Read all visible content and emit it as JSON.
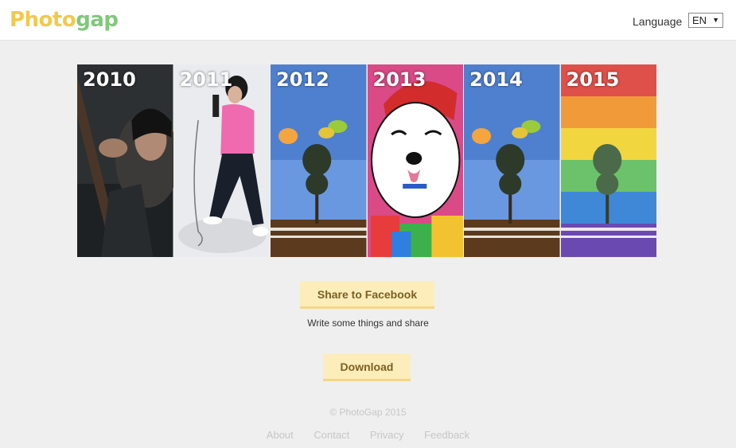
{
  "header": {
    "logo_part1": "Photo",
    "logo_part2": "gap",
    "language_label": "Language",
    "language_value": "EN"
  },
  "timeline": {
    "panels": [
      {
        "year": "2010",
        "icon": "guitar-portrait-photo"
      },
      {
        "year": "2011",
        "icon": "singer-microphone-photo"
      },
      {
        "year": "2012",
        "icon": "blue-sky-tree-photo"
      },
      {
        "year": "2013",
        "icon": "cartoon-dog-photo"
      },
      {
        "year": "2014",
        "icon": "blue-sky-tree-photo"
      },
      {
        "year": "2015",
        "icon": "rainbow-tree-photo"
      }
    ]
  },
  "actions": {
    "share_label": "Share to Facebook",
    "share_subtext": "Write some things and share",
    "download_label": "Download"
  },
  "footer": {
    "copyright": "© PhotoGap 2015",
    "links": [
      "About",
      "Contact",
      "Privacy",
      "Feedback"
    ]
  },
  "colors": {
    "logo_yellow": "#f2c94c",
    "logo_green": "#7fc97a",
    "button_bg": "#fdedbb",
    "button_text": "#7b6020",
    "page_bg": "#efefef"
  }
}
